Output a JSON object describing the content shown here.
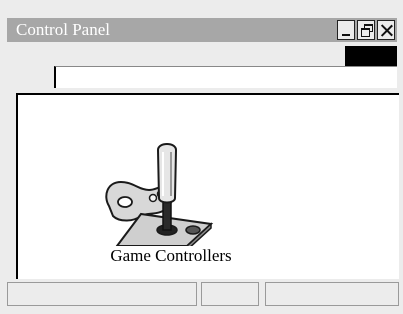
{
  "window": {
    "title": "Control Panel"
  },
  "address_bar": {
    "value": ""
  },
  "items": [
    {
      "label": "Game Controllers",
      "icon": "joystick-gamepad-icon"
    }
  ],
  "status_bar": {
    "pane1": "",
    "pane2": "",
    "pane3": ""
  },
  "colors": {
    "titlebar": "#a7a7a7",
    "window_bg": "#ececec"
  }
}
